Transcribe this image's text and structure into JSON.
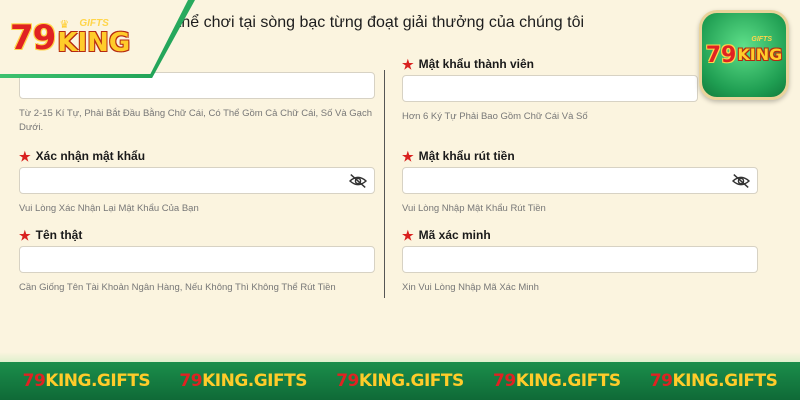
{
  "intro_text": "ra là có thể chơi tại sòng bạc từng đoạt giải thưởng của chúng tôi",
  "logo": {
    "number": "79",
    "word": "KING",
    "tag": "GIFTS"
  },
  "app_icon": {
    "number": "79",
    "word": "KING",
    "tag": "GIFTS"
  },
  "form": {
    "left": [
      {
        "label": "",
        "value": "",
        "hint_line1": "Từ 2-15 Kí Tự, Phải Bắt Đầu Bằng Chữ Cái, Có Thể Gồm Cả Chữ Cái, Số Và Gạch",
        "hint_line2": "Dưới."
      },
      {
        "label": "Xác nhận mật khẩu",
        "value": "",
        "hint": "Vui Lòng Xác Nhận Lại Mật Khẩu Của Bạn",
        "icon": "eye-slash-icon"
      },
      {
        "label": "Tên thật",
        "value": "",
        "hint": "Cần Giống Tên Tài Khoản Ngân Hàng, Nếu Không Thì Không Thể Rút Tiền"
      }
    ],
    "right": [
      {
        "label": "Mật khẩu thành viên",
        "value": "",
        "hint": "Hơn 6 Ký Tự Phải Bao Gồm Chữ Cái Và Số"
      },
      {
        "label": "Mật khẩu rút tiền",
        "value": "",
        "hint": "Vui Lòng Nhập Mật Khẩu Rút Tiền",
        "icon": "eye-slash-icon"
      },
      {
        "label": "Mã xác minh",
        "value": "",
        "hint": "Xin Vui Lòng Nhập Mã Xác Minh"
      }
    ]
  },
  "bottom_banner": [
    {
      "prefix": "79",
      "suffix": "KING.GIFTS"
    },
    {
      "prefix": "79",
      "suffix": "KING.GIFTS"
    },
    {
      "prefix": "79",
      "suffix": "KING.GIFTS"
    },
    {
      "prefix": "79",
      "suffix": "KING.GIFTS"
    },
    {
      "prefix": "79",
      "suffix": "KING.GIFTS"
    }
  ],
  "colors": {
    "background": "#fbf4df",
    "accent_green": "#1a9b52",
    "required_star": "#d9211f",
    "logo_red": "#e02222",
    "logo_gold": "#ffcc2a"
  }
}
